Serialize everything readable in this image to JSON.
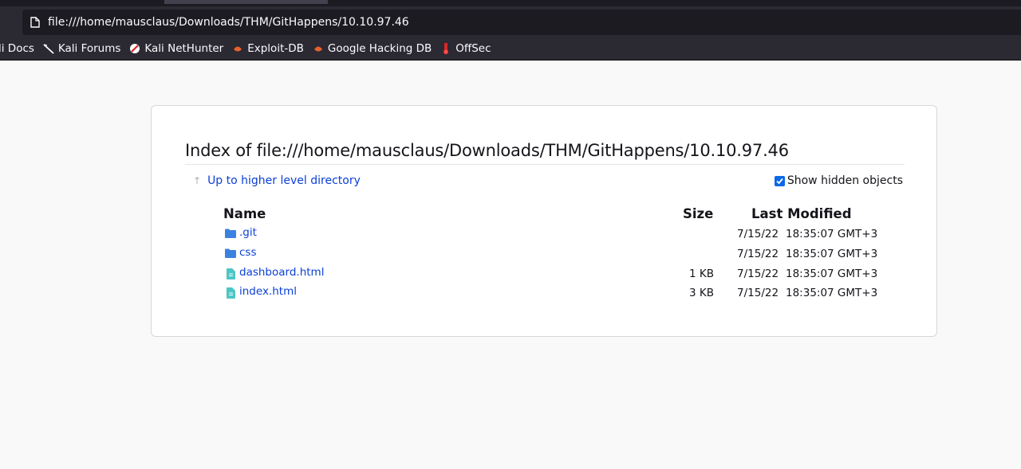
{
  "browser": {
    "url": "file:///home/mausclaus/Downloads/THM/GitHappens/10.10.97.46",
    "bookmarks": [
      {
        "label": "li Docs",
        "icon": "kali-docs-icon"
      },
      {
        "label": "Kali Forums",
        "icon": "kali-dragon-icon"
      },
      {
        "label": "Kali NetHunter",
        "icon": "nethunter-icon"
      },
      {
        "label": "Exploit-DB",
        "icon": "exploit-db-icon"
      },
      {
        "label": "Google Hacking DB",
        "icon": "ghdb-icon"
      },
      {
        "label": "OffSec",
        "icon": "offsec-icon"
      }
    ]
  },
  "listing": {
    "heading": "Index of file:///home/mausclaus/Downloads/THM/GitHappens/10.10.97.46",
    "up_link": "Up to higher level directory",
    "show_hidden_label": "Show hidden objects",
    "show_hidden_checked": true,
    "columns": {
      "name": "Name",
      "size": "Size",
      "modified": "Last Modified"
    },
    "rows": [
      {
        "name": ".git",
        "type": "folder",
        "size": "",
        "date": "7/15/22",
        "time": "18:35:07 GMT+3"
      },
      {
        "name": "css",
        "type": "folder",
        "size": "",
        "date": "7/15/22",
        "time": "18:35:07 GMT+3"
      },
      {
        "name": "dashboard.html",
        "type": "file",
        "size": "1 KB",
        "date": "7/15/22",
        "time": "18:35:07 GMT+3"
      },
      {
        "name": "index.html",
        "type": "file",
        "size": "3 KB",
        "date": "7/15/22",
        "time": "18:35:07 GMT+3"
      }
    ]
  },
  "colors": {
    "link": "#0a3fd6",
    "folder": "#3b82e0",
    "file": "#4cc5c5",
    "chrome": "#2b2a33"
  }
}
